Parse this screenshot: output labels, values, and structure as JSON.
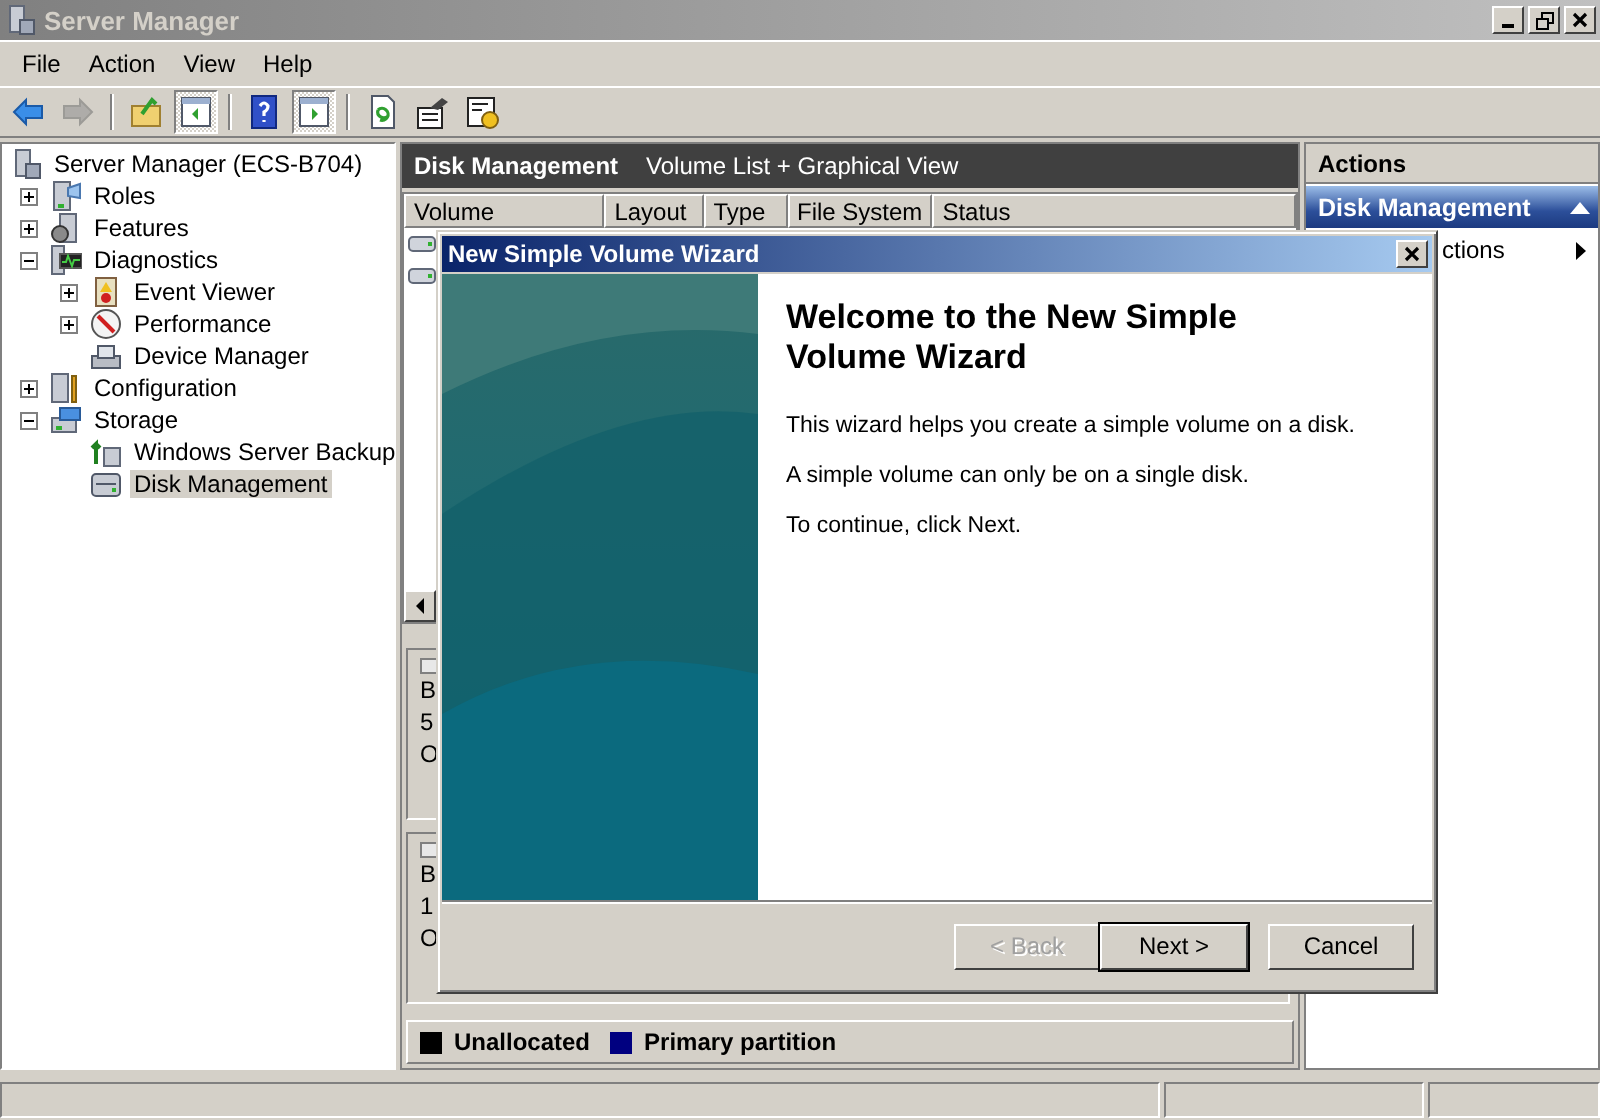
{
  "window": {
    "title": "Server Manager"
  },
  "menu": [
    "File",
    "Action",
    "View",
    "Help"
  ],
  "toolbar": [
    {
      "kind": "back",
      "disabled": false,
      "pressed": false
    },
    {
      "kind": "forward",
      "disabled": true,
      "pressed": false
    },
    {
      "kind": "separator"
    },
    {
      "kind": "up",
      "disabled": false,
      "pressed": false
    },
    {
      "kind": "console-tree",
      "disabled": false,
      "pressed": true
    },
    {
      "kind": "separator"
    },
    {
      "kind": "help",
      "disabled": false,
      "pressed": false
    },
    {
      "kind": "action-pane",
      "disabled": false,
      "pressed": true
    },
    {
      "kind": "separator"
    },
    {
      "kind": "export",
      "disabled": false,
      "pressed": false
    },
    {
      "kind": "properties",
      "disabled": false,
      "pressed": false
    },
    {
      "kind": "settings",
      "disabled": false,
      "pressed": false
    }
  ],
  "tree": {
    "label": "Server Manager (ECS-B704)",
    "kind": "server",
    "selected": false,
    "children": [
      {
        "label": "Roles",
        "kind": "roles",
        "expandable": true,
        "expanded": false,
        "selected": false
      },
      {
        "label": "Features",
        "kind": "features",
        "expandable": true,
        "expanded": false,
        "selected": false
      },
      {
        "label": "Diagnostics",
        "kind": "diagnostics",
        "expandable": true,
        "expanded": true,
        "selected": false,
        "children": [
          {
            "label": "Event Viewer",
            "kind": "event-viewer",
            "expandable": true,
            "expanded": false,
            "selected": false
          },
          {
            "label": "Performance",
            "kind": "performance",
            "expandable": true,
            "expanded": false,
            "selected": false
          },
          {
            "label": "Device Manager",
            "kind": "device-manager",
            "expandable": false,
            "selected": false
          }
        ]
      },
      {
        "label": "Configuration",
        "kind": "configuration",
        "expandable": true,
        "expanded": false,
        "selected": false
      },
      {
        "label": "Storage",
        "kind": "storage",
        "expandable": true,
        "expanded": true,
        "selected": false,
        "children": [
          {
            "label": "Windows Server Backup",
            "kind": "backup",
            "expandable": false,
            "selected": false
          },
          {
            "label": "Disk Management",
            "kind": "disk",
            "expandable": false,
            "selected": true
          }
        ]
      }
    ]
  },
  "center": {
    "title": "Disk Management",
    "view": "Volume List + Graphical View",
    "columns": [
      "Volume",
      "Layout",
      "Type",
      "File System",
      "Status"
    ],
    "disks": [
      {
        "lines": [
          "B",
          "5",
          "O"
        ]
      },
      {
        "lines": [
          "B",
          "1",
          "O"
        ]
      }
    ],
    "legend": [
      {
        "label": "Unallocated",
        "color": "#000000"
      },
      {
        "label": "Primary partition",
        "color": "#000080"
      }
    ]
  },
  "actions": {
    "title": "Actions",
    "section": "Disk Management",
    "items": [
      {
        "label": "ctions"
      }
    ]
  },
  "wizard": {
    "title": "New Simple Volume Wizard",
    "heading": "Welcome to the New Simple Volume Wizard",
    "paragraphs": [
      "This wizard helps you create a simple volume on a disk.",
      "A simple volume can only be on a single disk.",
      "To continue, click Next."
    ],
    "buttons": [
      {
        "label": "< Back",
        "disabled": true,
        "default": false
      },
      {
        "label": "Next >",
        "disabled": false,
        "default": true
      },
      {
        "label": "Cancel",
        "disabled": false,
        "default": false
      }
    ]
  }
}
